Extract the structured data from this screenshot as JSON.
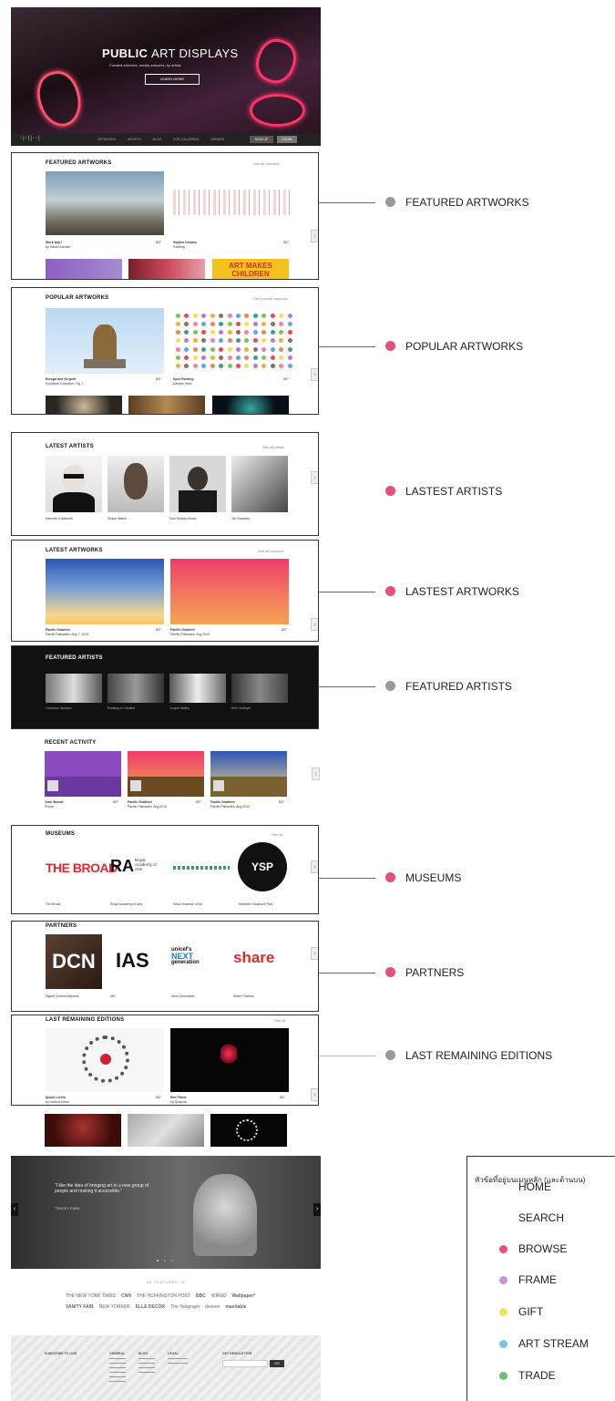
{
  "hero": {
    "title_bold": "PUBLIC",
    "title_rest": "ART DISPLAYS",
    "subtitle": "Curated artworks, mostly artworks, by artists",
    "button": "LEARN MORE",
    "nav_items": [
      "ARTWORKS",
      "ARTISTS",
      "BLOG",
      "FOR GALLERIES",
      "ORDERS"
    ],
    "signin": "SIGN UP",
    "login": "LOGIN"
  },
  "featured_artworks": {
    "title": "FEATURED ARTWORKS",
    "link": "See all artworks",
    "items": [
      {
        "title": "Work Day?",
        "artist": "by Daniel Arsham",
        "price": "$37"
      },
      {
        "title": "Skyline Dreams",
        "artist": "Painting",
        "price": "$37"
      }
    ],
    "row2_text": "ART MAKES CHILDREN"
  },
  "popular_artworks": {
    "title": "POPULAR ARTWORKS",
    "link": "See popular artworks",
    "items": [
      {
        "title": "Europa and Serpent",
        "artist": "Sculpture Collection, Fig. 1",
        "price": "$37"
      },
      {
        "title": "Spot Painting",
        "artist": "Damien Hirst",
        "price": "$37"
      }
    ]
  },
  "latest_artists": {
    "title": "LATEST ARTISTS",
    "link": "See all artists",
    "names": [
      "Kenneth Goldsmith",
      "Shane Walsh",
      "Dion Mclean Booth",
      "Jim Sanchez"
    ]
  },
  "latest_artworks": {
    "title": "LATEST ARTWORKS",
    "link": "See all artworks",
    "items": [
      {
        "title": "Pacific Gradient",
        "artist": "Pacific Palisades, Aug 7, 2014",
        "price": "$37"
      },
      {
        "title": "Pacific Gradient",
        "artist": "Pacific Palisades, Aug 2014",
        "price": "$37"
      }
    ]
  },
  "featured_artists": {
    "title": "FEATURED ARTISTS",
    "names": [
      "Laurence Jackson",
      "Rotating & Candles",
      "Cooper Bailey",
      "Rob Guilfoyle"
    ]
  },
  "recent_activity": {
    "title": "RECENT ACTIVITY",
    "items": [
      {
        "title": "Jean Woods",
        "artist": "Purple",
        "price": "$37"
      },
      {
        "title": "Pacific Gradient",
        "artist": "Pacific Palisades, Aug 2014",
        "price": "$37"
      },
      {
        "title": "Pacific Gradient",
        "artist": "Pacific Palisades, Aug 2014",
        "price": "$37"
      }
    ]
  },
  "museums": {
    "title": "MUSEUMS",
    "link": "See all",
    "logos": [
      "THE BROAD",
      "RA",
      "Royal Academy of Arts",
      "YSP"
    ],
    "names": [
      "The Broad",
      "Royal Academy of Arts",
      "Seoul Museum of Art",
      "Yorkshire Sculpture Park"
    ]
  },
  "partners": {
    "title": "PARTNERS",
    "logos": [
      "DCN",
      "IAS",
      "unicef's",
      "NEXT",
      "generation",
      "share"
    ],
    "names": [
      "Digital Content Network",
      "IAS",
      "Next Generation",
      "Share Festival"
    ]
  },
  "last_editions": {
    "title": "LAST REMAINING EDITIONS",
    "link": "See all",
    "items": [
      {
        "title": "Ipsum Lorem",
        "artist": "by Joshua Davis",
        "price": "$37"
      },
      {
        "title": "Red Flame",
        "artist": "by Quayola",
        "price": "$37"
      }
    ]
  },
  "testimonial": {
    "quote": "“I like the idea of bringing art to a new group of people and making it accessible.”",
    "author": "TRACEY EMIN"
  },
  "press": {
    "label": "AS FEATURED IN",
    "row1": [
      "THE NEW YORK TIMES",
      "CNN",
      "THE HUFFINGTON POST",
      "BBC",
      "WIRED",
      "Wallpaper*"
    ],
    "row2": [
      "VANITY FAIR",
      "NEW YORKER",
      "ELLE DECOR",
      "The Telegraph",
      "dezeen",
      "mashable"
    ]
  },
  "footer": {
    "cols": [
      "SUBSCRIBE TO OUR",
      "GENERAL",
      "BLOG",
      "LEGAL",
      "GET NEWSLETTER"
    ],
    "button": "GO"
  },
  "annotations": [
    {
      "label": "FEATURED ARTWORKS",
      "color": "#9a9a9a"
    },
    {
      "label": "POPULAR ARTWORKS",
      "color": "#e5507a"
    },
    {
      "label": "LASTEST ARTISTS",
      "color": "#e5507a"
    },
    {
      "label": "LASTEST ARTWORKS",
      "color": "#e5507a"
    },
    {
      "label": "FEATURED ARTISTS",
      "color": "#9a9a9a"
    },
    {
      "label": "MUSEUMS",
      "color": "#e5507a"
    },
    {
      "label": "PARTNERS",
      "color": "#e5507a"
    },
    {
      "label": "LAST REMAINING EDITIONS",
      "color": "#9a9a9a"
    }
  ],
  "legend": {
    "title": "หัวข้อที่อยู่บนเมนูหลัก (และด้านบน)",
    "items": [
      {
        "label": "HOME",
        "color": ""
      },
      {
        "label": "SEARCH",
        "color": ""
      },
      {
        "label": "BROWSE",
        "color": "#e5507a"
      },
      {
        "label": "FRAME",
        "color": "#c993cc"
      },
      {
        "label": "GIFT",
        "color": "#ede45a"
      },
      {
        "label": "ART STREAM",
        "color": "#79c4dc"
      },
      {
        "label": "TRADE",
        "color": "#6bbf7c"
      }
    ]
  }
}
